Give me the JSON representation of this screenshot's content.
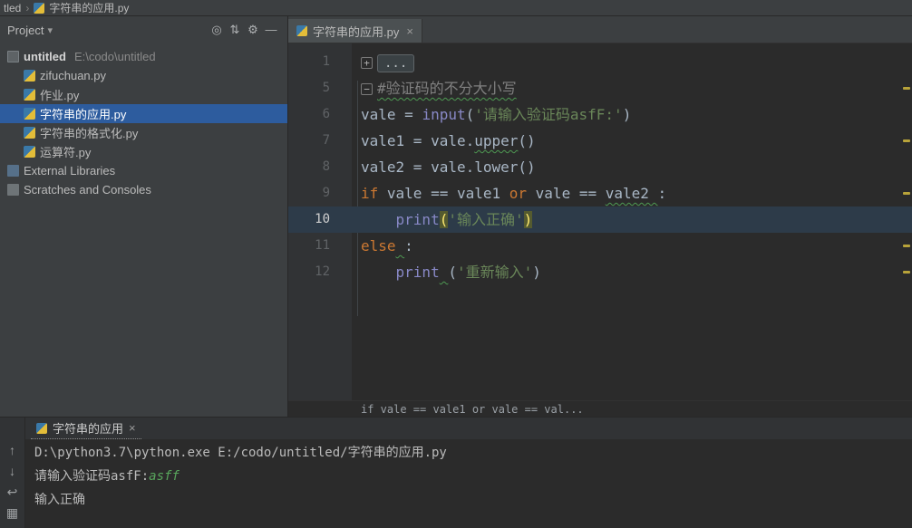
{
  "breadcrumb": {
    "root": "tled",
    "separator": "›",
    "file": "字符串的应用.py"
  },
  "project": {
    "title": "Project",
    "caret": "▾",
    "toolbar_icons": [
      {
        "glyph": "◎",
        "name": "locate-icon"
      },
      {
        "glyph": "⇅",
        "name": "collapse-all-icon"
      },
      {
        "glyph": "⚙",
        "name": "settings-gear-icon"
      },
      {
        "glyph": "—",
        "name": "hide-panel-icon"
      }
    ],
    "items": [
      {
        "label": "untitled",
        "path": "E:\\codo\\untitled",
        "icon": "folder",
        "indent": 0,
        "bold": true
      },
      {
        "label": "zifuchuan.py",
        "icon": "py",
        "indent": 1
      },
      {
        "label": "作业.py",
        "icon": "py",
        "indent": 1
      },
      {
        "label": "字符串的应用.py",
        "icon": "py",
        "indent": 1,
        "selected": true
      },
      {
        "label": "字符串的格式化.py",
        "icon": "py",
        "indent": 1
      },
      {
        "label": "运算符.py",
        "icon": "py",
        "indent": 1
      },
      {
        "label": "External Libraries",
        "icon": "lib",
        "indent": 0
      },
      {
        "label": "Scratches and Consoles",
        "icon": "scratch",
        "indent": 0
      }
    ]
  },
  "editor": {
    "tab_label": "字符串的应用.py",
    "tab_close": "×",
    "context_bar": "if vale == vale1 or vale == val...",
    "lines": [
      {
        "num": "1",
        "fold": "plus",
        "segments": [
          {
            "t": "...",
            "cls": "fold-pill"
          }
        ]
      },
      {
        "num": "5",
        "fold": "minus",
        "segments": [
          {
            "t": "#验证码的不分大小写",
            "cls": "tok-comment sq"
          }
        ]
      },
      {
        "num": "6",
        "segments": [
          {
            "t": "vale = ",
            "cls": "tok-plain"
          },
          {
            "t": "input",
            "cls": "tok-builtin"
          },
          {
            "t": "(",
            "cls": "tok-plain"
          },
          {
            "t": "'请输入验证码asfF:'",
            "cls": "tok-str"
          },
          {
            "t": ")",
            "cls": "tok-plain"
          }
        ]
      },
      {
        "num": "7",
        "segments": [
          {
            "t": "vale1 = vale.",
            "cls": "tok-plain"
          },
          {
            "t": "upper",
            "cls": "tok-plain sq"
          },
          {
            "t": "()",
            "cls": "tok-plain"
          }
        ]
      },
      {
        "num": "8",
        "segments": [
          {
            "t": "vale2 = vale.lower()",
            "cls": "tok-plain"
          }
        ]
      },
      {
        "num": "9",
        "segments": [
          {
            "t": "if ",
            "cls": "tok-kw"
          },
          {
            "t": "vale == vale1 ",
            "cls": "tok-plain"
          },
          {
            "t": "or",
            "cls": "tok-kw"
          },
          {
            "t": " vale == ",
            "cls": "tok-plain"
          },
          {
            "t": "vale2 ",
            "cls": "tok-plain sq"
          },
          {
            "t": ":",
            "cls": "tok-plain"
          }
        ]
      },
      {
        "num": "10",
        "current": true,
        "segments": [
          {
            "t": "    ",
            "cls": "tok-plain"
          },
          {
            "t": "print",
            "cls": "tok-builtin"
          },
          {
            "t": "(",
            "cls": "tok-brace"
          },
          {
            "t": "'输入正确'",
            "cls": "tok-str"
          },
          {
            "t": ")",
            "cls": "tok-brace"
          }
        ]
      },
      {
        "num": "11",
        "segments": [
          {
            "t": "else",
            "cls": "tok-kw"
          },
          {
            "t": " ",
            "cls": "tok-plain sq"
          },
          {
            "t": ":",
            "cls": "tok-plain"
          }
        ]
      },
      {
        "num": "12",
        "segments": [
          {
            "t": "    ",
            "cls": "tok-plain"
          },
          {
            "t": "print",
            "cls": "tok-builtin"
          },
          {
            "t": " ",
            "cls": "tok-plain sq"
          },
          {
            "t": "(",
            "cls": "tok-plain"
          },
          {
            "t": "'重新输入'",
            "cls": "tok-str"
          },
          {
            "t": ")",
            "cls": "tok-plain"
          }
        ]
      }
    ]
  },
  "console": {
    "tab_label": "字符串的应用",
    "tab_close": "×",
    "lines": [
      {
        "segments": [
          {
            "t": "D:\\python3.7\\python.exe E:/codo/untitled/字符串的应用.py",
            "cls": "con-out"
          }
        ]
      },
      {
        "segments": [
          {
            "t": "请输入验证码asfF:",
            "cls": "con-out"
          },
          {
            "t": "asff",
            "cls": "con-in"
          }
        ]
      },
      {
        "segments": [
          {
            "t": "输入正确",
            "cls": "con-out"
          }
        ]
      }
    ]
  },
  "run_icons": [
    {
      "glyph": "↑",
      "name": "up-arrow-icon"
    },
    {
      "glyph": "↓",
      "name": "down-arrow-icon"
    },
    {
      "glyph": "↩",
      "name": "soft-wrap-icon"
    },
    {
      "glyph": "▦",
      "name": "tool-windows-icon"
    }
  ],
  "colors": {
    "selection": "#2d5c9e",
    "keyword": "#cc7832",
    "builtin": "#8888c6",
    "string": "#6a8759",
    "comment": "#808080",
    "console_input": "#58a55c",
    "current_line": "#2d3b49",
    "warning_stripe": "#b8a33a"
  }
}
